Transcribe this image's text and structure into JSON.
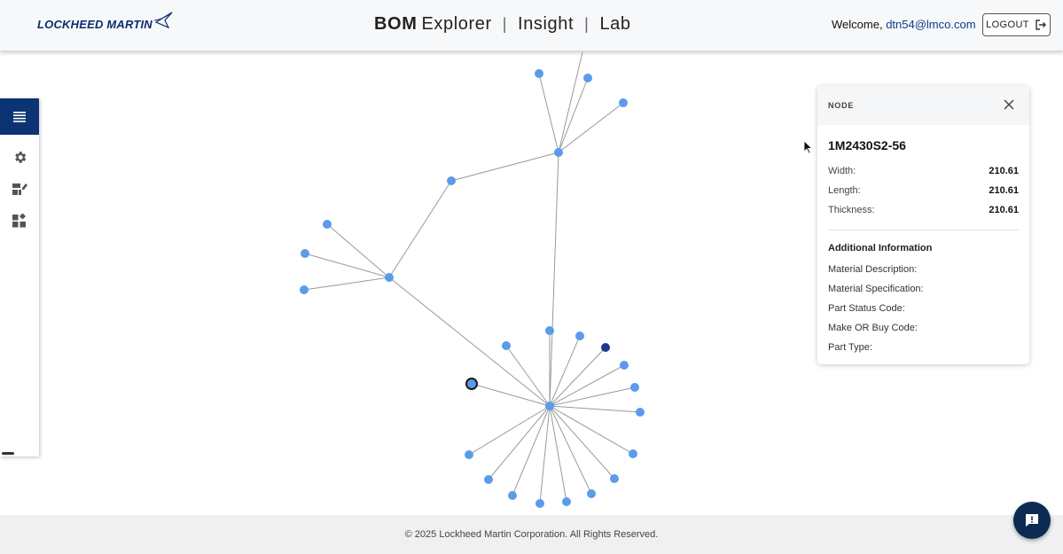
{
  "header": {
    "logo_text": "LOCKHEED MARTIN",
    "title_parts": [
      "BOM",
      "Explorer",
      "|",
      "Insight",
      "|",
      "Lab"
    ],
    "welcome_prefix": "Welcome,",
    "user": "dtn54@lmco.com",
    "logout_label": "LOGOUT"
  },
  "rail": {
    "items": [
      {
        "name": "menu",
        "icon": "menu-icon",
        "active": true
      },
      {
        "name": "settings",
        "icon": "gear-icon"
      },
      {
        "name": "dashboard",
        "icon": "dashboard-edit-icon"
      },
      {
        "name": "widgets",
        "icon": "widgets-icon"
      }
    ]
  },
  "panel": {
    "header_label": "NODE",
    "node_name": "1M2430S2-56",
    "dimensions": [
      {
        "label": "Width:",
        "value": "210.61"
      },
      {
        "label": "Length:",
        "value": "210.61"
      },
      {
        "label": "Thickness:",
        "value": "210.61"
      }
    ],
    "additional_title": "Additional Information",
    "fields": [
      {
        "label": "Material Description:"
      },
      {
        "label": "Material Specification:"
      },
      {
        "label": "Part Status Code:"
      },
      {
        "label": "Make OR Buy Code:"
      },
      {
        "label": "Part Type:"
      }
    ]
  },
  "footer": {
    "copyright": "© 2025 Lockheed Martin Corporation. All Rights Reserved."
  },
  "colors": {
    "brand_navy": "#0c3373",
    "node_default": "#5b9bea",
    "node_dark": "#1b3a8c",
    "edge": "#9a9a9a",
    "fab": "#0d2a54"
  }
}
